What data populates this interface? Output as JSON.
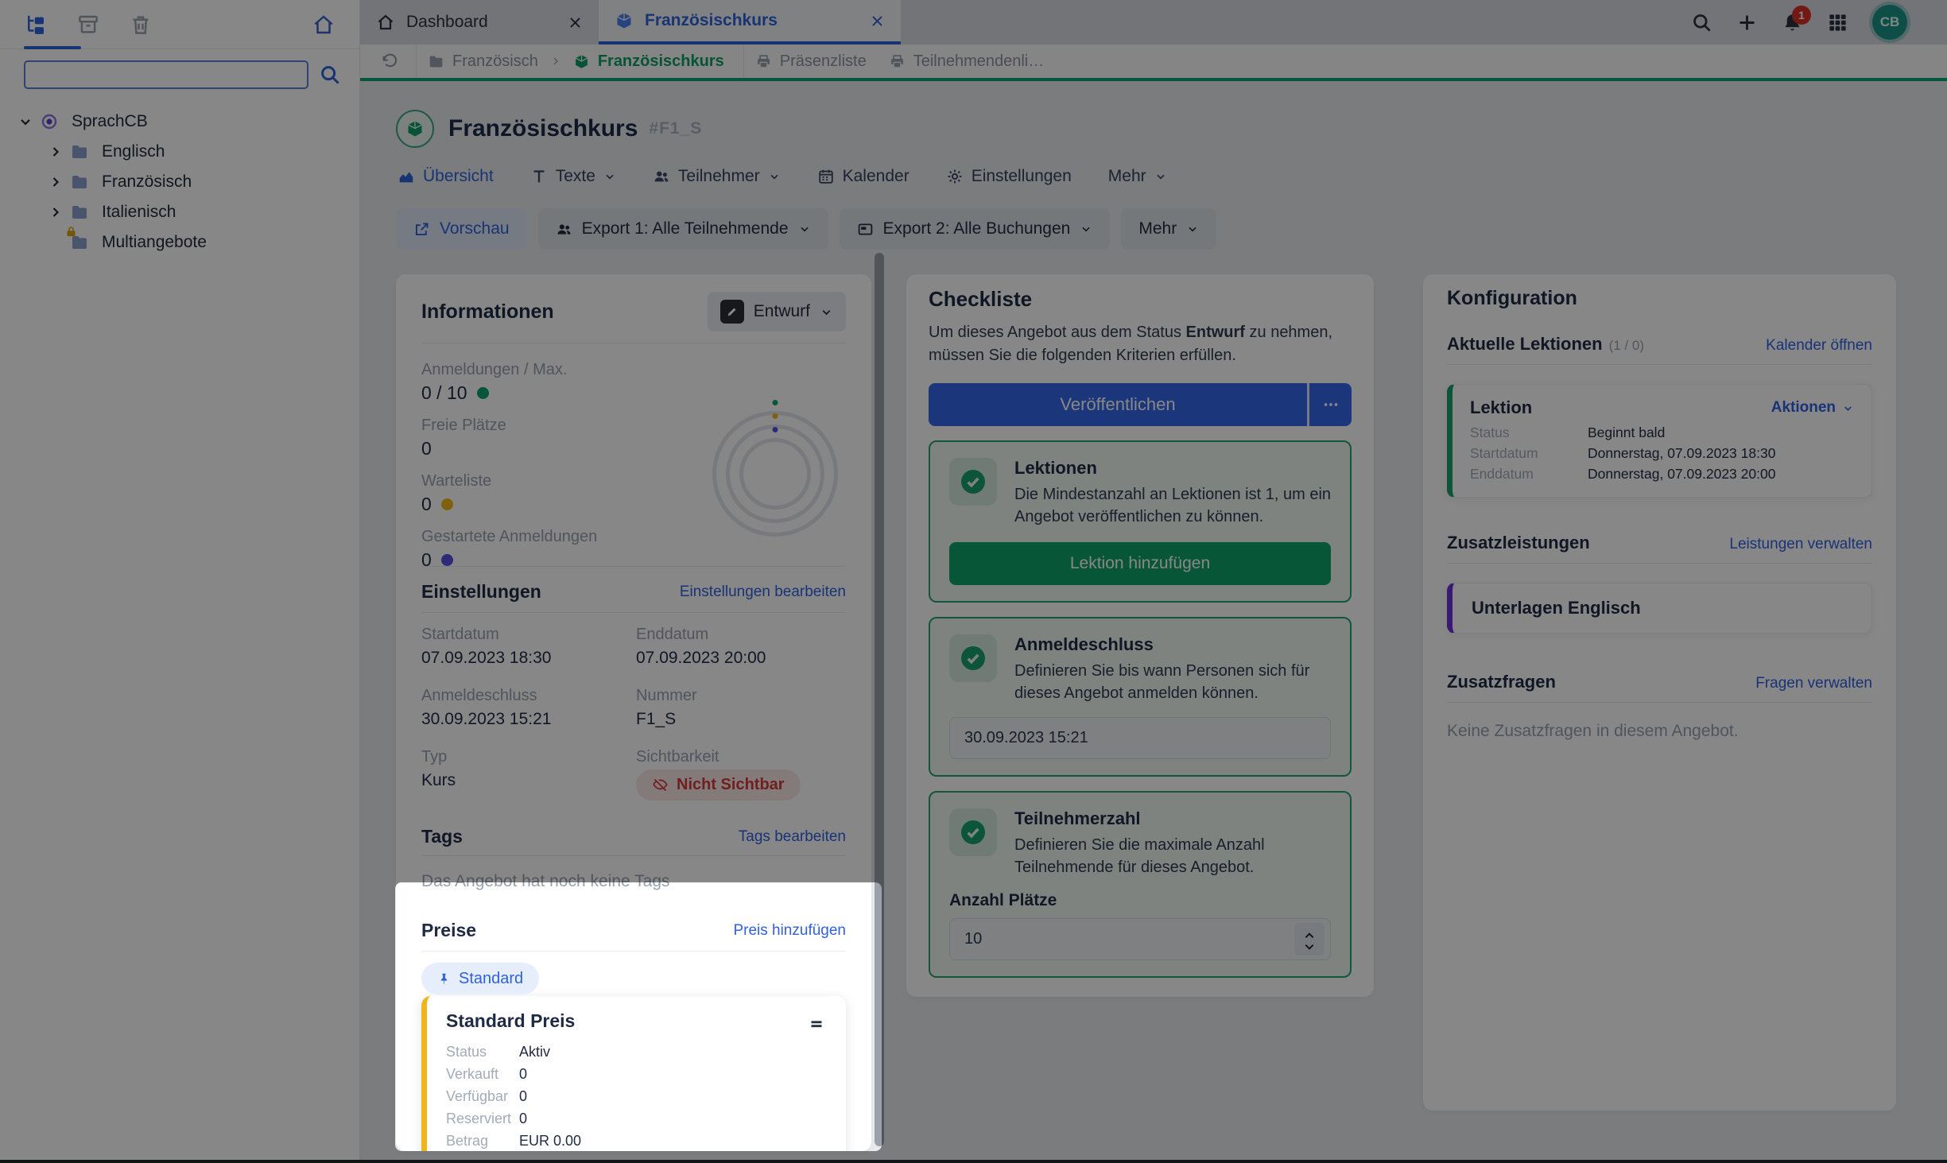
{
  "colors": {
    "accent_blue": "#3060e0",
    "brand_green": "#0ba06c",
    "warning_amber": "#f3b619",
    "indigo": "#5850e6",
    "purple": "#6d30d9",
    "danger_red": "#d23b3b",
    "price_yellow": "#f2b41c",
    "avatar_teal": "#1b9488",
    "dim_overlay": "rgba(0,0,0,0.47)"
  },
  "topbar": {
    "tabs": [
      {
        "label": "Dashboard"
      },
      {
        "label": "Französischkurs"
      }
    ],
    "notification_count": "1",
    "avatar_initials": "CB"
  },
  "breadcrumb": {
    "folder": "Französisch",
    "current": "Französischkurs",
    "print_links": [
      "Präsenzliste",
      "Teilnehmendenli…"
    ]
  },
  "sidebar": {
    "search_value": "",
    "root_label": "SprachCB",
    "items": [
      {
        "label": "Englisch"
      },
      {
        "label": "Französisch"
      },
      {
        "label": "Italienisch"
      },
      {
        "label": "Multiangebote"
      }
    ]
  },
  "header": {
    "title": "Französischkurs",
    "code": "#F1_S",
    "tabs": [
      "Übersicht",
      "Texte",
      "Teilnehmer",
      "Kalender",
      "Einstellungen",
      "Mehr"
    ],
    "actions": [
      "Vorschau",
      "Export 1: Alle Teilnehmende",
      "Export 2: Alle Buchungen",
      "Mehr"
    ]
  },
  "info": {
    "title": "Informationen",
    "status_button": "Entwurf",
    "stats": [
      {
        "label": "Anmeldungen / Max.",
        "value": "0 / 10",
        "dot": "#0ba06c"
      },
      {
        "label": "Freie Plätze",
        "value": "0",
        "dot": ""
      },
      {
        "label": "Warteliste",
        "value": "0",
        "dot": "#f3b619"
      },
      {
        "label": "Gestartete Anmeldungen",
        "value": "0",
        "dot": "#5850e6"
      }
    ],
    "settings": {
      "title": "Einstellungen",
      "edit_link": "Einstellungen bearbeiten",
      "fields": [
        {
          "label": "Startdatum",
          "value": "07.09.2023 18:30"
        },
        {
          "label": "Enddatum",
          "value": "07.09.2023 20:00"
        },
        {
          "label": "Anmeldeschluss",
          "value": "30.09.2023 15:21"
        },
        {
          "label": "Nummer",
          "value": "F1_S"
        },
        {
          "label": "Typ",
          "value": "Kurs"
        },
        {
          "label": "Sichtbarkeit",
          "value": "Nicht Sichtbar"
        }
      ]
    },
    "tags": {
      "title": "Tags",
      "edit_link": "Tags bearbeiten",
      "empty_text": "Das Angebot hat noch keine Tags"
    },
    "prices": {
      "title": "Preise",
      "add_link": "Preis hinzufügen",
      "badge": "Standard",
      "card": {
        "title": "Standard Preis",
        "rows": [
          {
            "label": "Status",
            "value": "Aktiv"
          },
          {
            "label": "Verkauft",
            "value": "0"
          },
          {
            "label": "Verfügbar",
            "value": "0"
          },
          {
            "label": "Reserviert",
            "value": "0"
          },
          {
            "label": "Betrag",
            "value": "EUR 0.00"
          }
        ]
      }
    }
  },
  "checklist": {
    "title": "Checkliste",
    "intro_pre": "Um dieses Angebot aus dem Status ",
    "intro_bold": "Entwurf",
    "intro_post": " zu nehmen, müssen Sie die folgenden Kriterien erfüllen.",
    "publish_button": "Veröffentlichen",
    "items": [
      {
        "title": "Lektionen",
        "text": "Die Mindestanzahl an Lektionen ist 1, um ein Angebot veröffentlichen zu können.",
        "button": "Lektion hinzufügen"
      },
      {
        "title": "Anmeldeschluss",
        "text": "Definieren Sie bis wann Personen sich für dieses Angebot anmelden können.",
        "input_value": "30.09.2023 15:21"
      },
      {
        "title": "Teilnehmerzahl",
        "text": "Definieren Sie die maximale Anzahl Teilnehmende für dieses Angebot.",
        "input_label": "Anzahl Plätze",
        "input_value": "10"
      }
    ]
  },
  "config": {
    "title": "Konfiguration",
    "lessons": {
      "title": "Aktuelle Lektionen",
      "count": "(1 / 0)",
      "link": "Kalender öffnen",
      "card": {
        "title": "Lektion",
        "menu": "Aktionen",
        "rows": [
          {
            "label": "Status",
            "value": "Beginnt bald"
          },
          {
            "label": "Startdatum",
            "value": "Donnerstag, 07.09.2023 18:30"
          },
          {
            "label": "Enddatum",
            "value": "Donnerstag, 07.09.2023 20:00"
          }
        ]
      }
    },
    "services": {
      "title": "Zusatzleistungen",
      "link": "Leistungen verwalten",
      "card_title": "Unterlagen Englisch"
    },
    "questions": {
      "title": "Zusatzfragen",
      "link": "Fragen verwalten",
      "empty_text": "Keine Zusatzfragen in diesem Angebot."
    }
  }
}
